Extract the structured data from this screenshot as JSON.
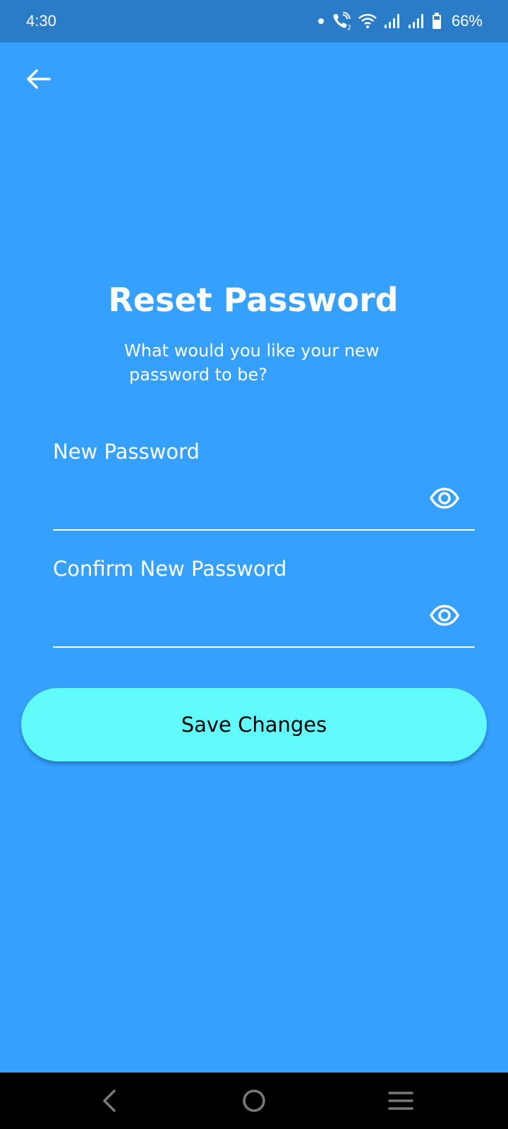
{
  "status_bar": {
    "time": "4:30",
    "battery_percent": "66%",
    "icons": [
      "dot-icon",
      "wifi-call-icon",
      "wifi-icon",
      "signal-icon",
      "signal-icon",
      "battery-icon"
    ]
  },
  "header": {
    "back_icon": "arrow-left-icon"
  },
  "main": {
    "title": "Reset Password",
    "subtitle_line1": "What would you like your new",
    "subtitle_line2": "password to be?"
  },
  "form": {
    "new_password": {
      "label": "New Password",
      "value": "",
      "toggle_icon": "eye-icon"
    },
    "confirm_password": {
      "label": "Confirm New Password",
      "value": "",
      "toggle_icon": "eye-icon"
    },
    "save_label": "Save Changes"
  },
  "nav_bar": {
    "buttons": [
      "back-chevron-icon",
      "home-circle-icon",
      "menu-lines-icon"
    ]
  },
  "colors": {
    "background": "#36A0FF",
    "status_bar": "#2B7CC6",
    "button": "#62FBFB",
    "text": "#FFFFFF"
  }
}
